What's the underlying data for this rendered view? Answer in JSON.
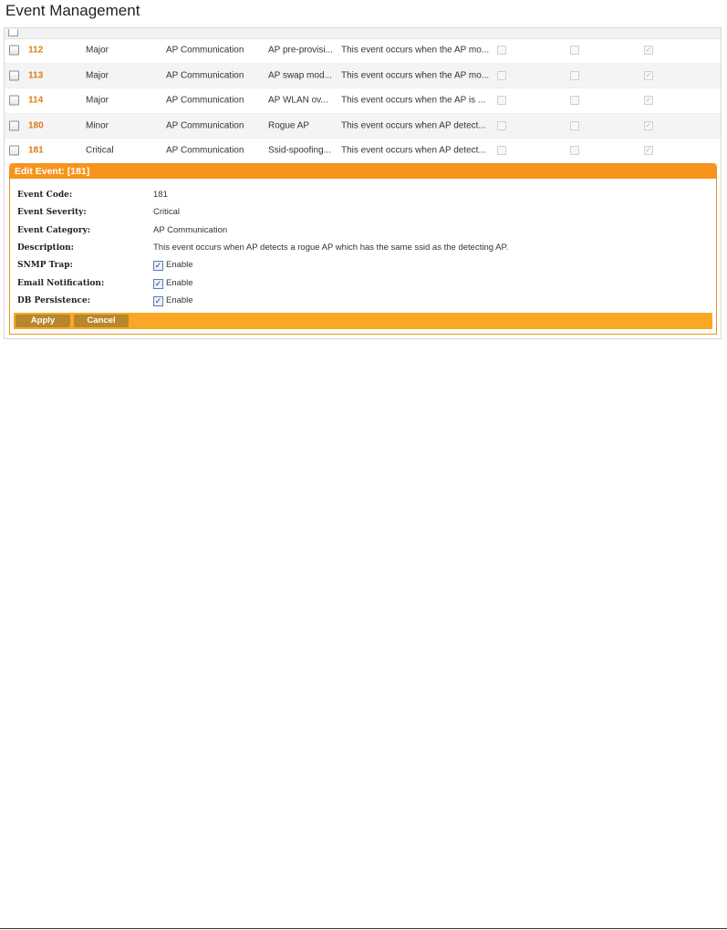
{
  "page": {
    "title": "Event Management"
  },
  "events": [
    {
      "code": "112",
      "severity": "Major",
      "category": "AP Communication",
      "name": "AP pre-provisi...",
      "description": "This event occurs when the AP mo...",
      "snmp": "✓",
      "email": "✓",
      "db": "✓"
    },
    {
      "code": "113",
      "severity": "Major",
      "category": "AP Communication",
      "name": "AP swap mod...",
      "description": "This event occurs when the AP mo...",
      "snmp": "✓",
      "email": "✓",
      "db": "✓"
    },
    {
      "code": "114",
      "severity": "Major",
      "category": "AP Communication",
      "name": "AP WLAN ov...",
      "description": "This event occurs when the AP is ...",
      "snmp": "✓",
      "email": "✓",
      "db": "✓"
    },
    {
      "code": "180",
      "severity": "Minor",
      "category": "AP Communication",
      "name": "Rogue AP",
      "description": "This event occurs when AP detect...",
      "snmp": "✓",
      "email": "✓",
      "db": "✓"
    },
    {
      "code": "181",
      "severity": "Critical",
      "category": "AP Communication",
      "name": "Ssid-spoofing...",
      "description": "This event occurs when AP detect...",
      "snmp": "✓",
      "email": "✓",
      "db": "✓"
    }
  ],
  "edit": {
    "header": "Edit Event: [181]",
    "labels": {
      "code": "Event Code:",
      "severity": "Event Severity:",
      "category": "Event Category:",
      "description": "Description:",
      "snmp": "SNMP Trap:",
      "email": "Email Notification:",
      "db": "DB Persistence:"
    },
    "values": {
      "code": "181",
      "severity": "Critical",
      "category": "AP Communication",
      "description": "This event occurs when AP detects a rogue AP which has the same ssid as the detecting AP.",
      "snmp": "Enable",
      "email": "Enable",
      "db": "Enable"
    },
    "check_mark": "✓",
    "buttons": {
      "apply": "Apply",
      "cancel": "Cancel"
    }
  },
  "colors": {
    "accent": "#f7941d",
    "code_text": "#e07a10",
    "button": "#b8862b"
  }
}
